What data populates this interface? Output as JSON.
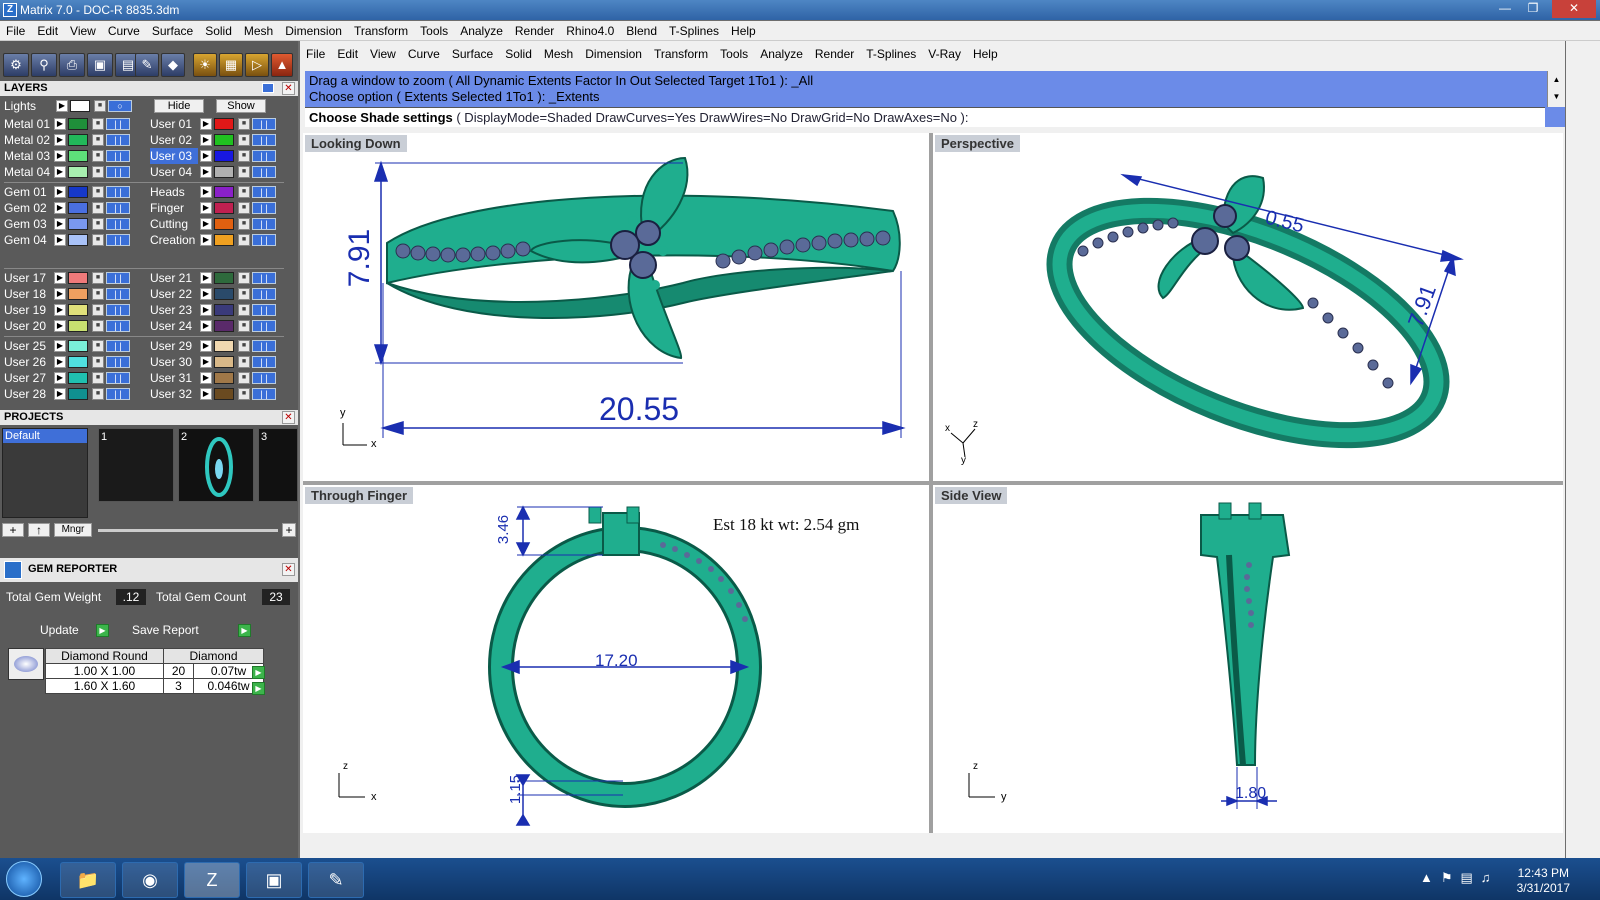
{
  "window": {
    "title": "Matrix 7.0 - DOC-R 8835.3dm",
    "app_icon": "Z"
  },
  "menu1": [
    "File",
    "Edit",
    "View",
    "Curve",
    "Surface",
    "Solid",
    "Mesh",
    "Dimension",
    "Transform",
    "Tools",
    "Analyze",
    "Render",
    "Rhino4.0",
    "Blend",
    "T-Splines",
    "Help"
  ],
  "menu2": [
    "File",
    "Edit",
    "View",
    "Curve",
    "Surface",
    "Solid",
    "Mesh",
    "Dimension",
    "Transform",
    "Tools",
    "Analyze",
    "Render",
    "T-Splines",
    "V-Ray",
    "Help"
  ],
  "command": {
    "line1": "Drag a window to zoom ( All  Dynamic  Extents  Factor  In  Out  Selected  Target  1To1 ): _All",
    "line2": "Choose option ( Extents  Selected  1To1 ): _Extents",
    "prompt_bold": "Choose Shade settings",
    "prompt_rest": " ( DisplayMode=Shaded  DrawCurves=Yes  DrawWires=No  DrawGrid=No  DrawAxes=No ):"
  },
  "layers": {
    "title": "LAYERS",
    "lights": "Lights",
    "hide": "Hide",
    "show": "Show",
    "left_groups": [
      [
        {
          "name": "Metal 01",
          "color": "#1f8f3a"
        },
        {
          "name": "Metal 02",
          "color": "#22b85a"
        },
        {
          "name": "Metal 03",
          "color": "#5ee07a"
        },
        {
          "name": "Metal 04",
          "color": "#a8f0b0"
        }
      ],
      [
        {
          "name": "Gem 01",
          "color": "#1638c8"
        },
        {
          "name": "Gem 02",
          "color": "#4a6fe0"
        },
        {
          "name": "Gem 03",
          "color": "#7a98f0"
        },
        {
          "name": "Gem 04",
          "color": "#a9c2f8"
        }
      ],
      [
        {
          "name": "User 17",
          "color": "#f07a7a"
        },
        {
          "name": "User 18",
          "color": "#f0a060"
        },
        {
          "name": "User 19",
          "color": "#e0e07a"
        },
        {
          "name": "User 20",
          "color": "#c8e070"
        }
      ],
      [
        {
          "name": "User 25",
          "color": "#7af0d8"
        },
        {
          "name": "User 26",
          "color": "#50e0e0"
        },
        {
          "name": "User 27",
          "color": "#20c0b0"
        },
        {
          "name": "User 28",
          "color": "#109090"
        }
      ]
    ],
    "right_groups": [
      [
        {
          "name": "User 01",
          "color": "#e01818"
        },
        {
          "name": "User 02",
          "color": "#20c020"
        },
        {
          "name": "User 03",
          "color": "#1818e0",
          "selected": true
        },
        {
          "name": "User 04",
          "color": "#b0b0b0"
        }
      ],
      [
        {
          "name": "Heads",
          "color": "#8a20c8"
        },
        {
          "name": "Finger",
          "color": "#c02050"
        },
        {
          "name": "Cutting",
          "color": "#e06010"
        },
        {
          "name": "Creation",
          "color": "#f0a020"
        }
      ],
      [
        {
          "name": "User 21",
          "color": "#2e6a3c"
        },
        {
          "name": "User 22",
          "color": "#2a4a6a"
        },
        {
          "name": "User 23",
          "color": "#3a3a7a"
        },
        {
          "name": "User 24",
          "color": "#5a2a6a"
        }
      ],
      [
        {
          "name": "User 29",
          "color": "#f0d8b0"
        },
        {
          "name": "User 30",
          "color": "#d8b888"
        },
        {
          "name": "User 31",
          "color": "#a07848"
        },
        {
          "name": "User 32",
          "color": "#6a4a20"
        }
      ]
    ]
  },
  "projects": {
    "title": "PROJECTS",
    "default": "Default",
    "slots": [
      "1",
      "2",
      "3"
    ],
    "mngr": "Mngr"
  },
  "gem_reporter": {
    "title": "GEM REPORTER",
    "total_weight_label": "Total Gem Weight",
    "total_weight": ".12",
    "total_count_label": "Total Gem Count",
    "total_count": "23",
    "update": "Update",
    "save_report": "Save Report",
    "col1": "Diamond Round",
    "col2": "Diamond",
    "rows": [
      {
        "size": "1.00 X 1.00",
        "count": "20",
        "wt": "0.07tw"
      },
      {
        "size": "1.60 X 1.60",
        "count": "3",
        "wt": "0.046tw"
      }
    ]
  },
  "viewports": {
    "top_left": {
      "label": "Looking Down",
      "dim_h": "7.91",
      "dim_w": "20.55",
      "ax_y": "y",
      "ax_x": "x"
    },
    "top_right": {
      "label": "Perspective",
      "dim_a": "0.55",
      "dim_b": "7.91",
      "ax_z": "z",
      "ax_x": "x",
      "ax_y": "y"
    },
    "bottom_left": {
      "label": "Through Finger",
      "dim_top": "3.46",
      "dim_inner": "17.20",
      "dim_bottom": "1.15",
      "weight_note": "Est 18 kt wt: 2.54 gm",
      "ax_z": "z",
      "ax_x": "x"
    },
    "bottom_right": {
      "label": "Side View",
      "dim": "1.80",
      "ax_z": "z",
      "ax_y": "y"
    }
  },
  "taskbar": {
    "time": "12:43 PM",
    "date": "3/31/2017"
  },
  "colors": {
    "metal": "#1fae8e",
    "metal_dark": "#0a5a48",
    "gem": "#5a6a98",
    "dim": "#1a2eb0"
  }
}
